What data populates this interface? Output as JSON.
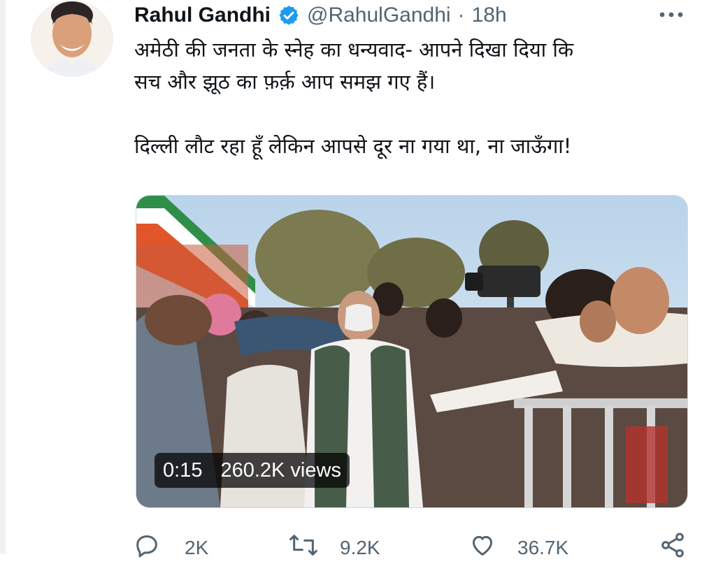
{
  "tweet": {
    "author_name": "Rahul Gandhi",
    "handle": "@RahulGandhi",
    "separator": "·",
    "time": "18h",
    "lines": [
      "अमेठी की जनता के स्नेह का धन्यवाद- आपने दिखा दिया कि",
      "सच और झूठ का फ़र्क़ आप समझ गए हैं।",
      "",
      "दिल्ली लौट रहा हूँ लेकिन आपसे दूर ना गया था, ना जाऊँगा!"
    ]
  },
  "media": {
    "duration": "0:15",
    "views": "260.2K views"
  },
  "actions": {
    "replies": "2K",
    "retweets": "9.2K",
    "likes": "36.7K"
  },
  "icons": {
    "verified": "verified-badge-icon",
    "more": "more-options-icon",
    "reply": "reply-icon",
    "retweet": "retweet-icon",
    "like": "heart-icon",
    "share": "share-icon"
  },
  "colors": {
    "verified_blue": "#1d9bf0",
    "text_primary": "#0f1419",
    "text_secondary": "#536471"
  }
}
